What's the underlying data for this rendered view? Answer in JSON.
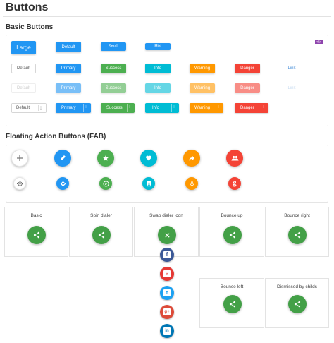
{
  "page": {
    "title": "Buttons"
  },
  "basic_buttons": {
    "title": "Basic Buttons",
    "sizes": {
      "large": "Large",
      "default": "Default",
      "small": "Small",
      "mini": "Mini"
    },
    "badge": "</>",
    "row_labels": [
      "Default",
      "Primary",
      "Success",
      "Info",
      "Warning",
      "Danger",
      "Link"
    ],
    "colors": {
      "primary": "#2196f3",
      "success": "#4caf50",
      "info": "#00bcd4",
      "warning": "#ff9800",
      "danger": "#f44336",
      "link": "#4a90d9"
    }
  },
  "fab": {
    "title": "Floating Action Buttons (FAB)",
    "row1_icons": [
      "plus-icon",
      "pencil-icon",
      "star-icon",
      "heart-icon",
      "share-arrow-icon",
      "group-icon"
    ],
    "row2_icons": [
      "target-icon",
      "directions-icon",
      "compass-icon",
      "contact-icon",
      "mic-icon",
      "google-icon"
    ]
  },
  "dialers": {
    "cards": [
      "Basic",
      "Spin dialer",
      "Swap dialer icon",
      "Bounce up",
      "Bounce right",
      "Bounce left",
      "Dismissed by childs"
    ],
    "social_icons": [
      "facebook-icon",
      "pinterest-icon",
      "twitter-icon",
      "google-plus-icon",
      "linkedin-icon"
    ],
    "social_glyphs": [
      "f",
      "P",
      "t",
      "g+",
      "in"
    ],
    "fab_color": "#43a047"
  }
}
